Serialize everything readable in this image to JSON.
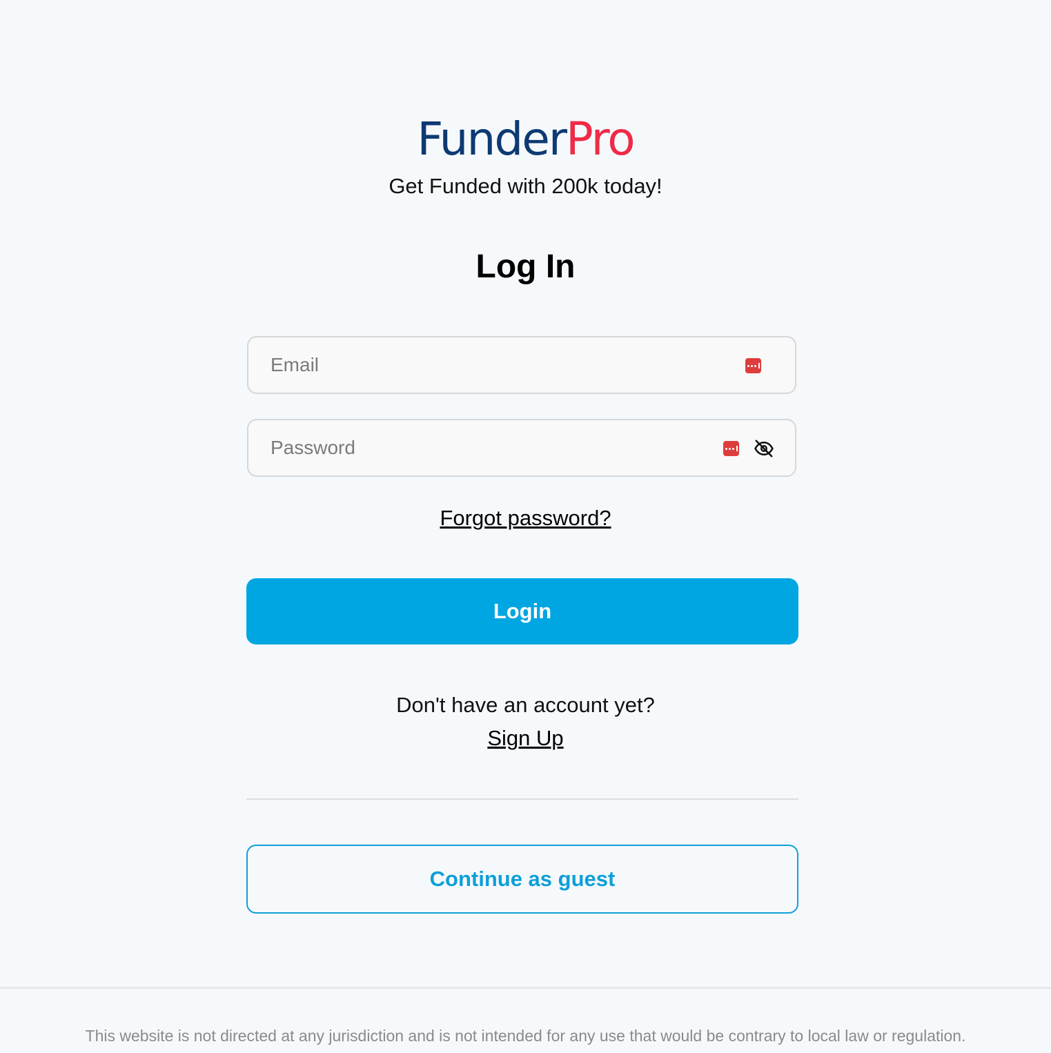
{
  "brand": {
    "name_part1": "Funder",
    "name_part2": "Pro",
    "color_primary": "#0d3a73",
    "color_accent": "#ef2b47"
  },
  "tagline": "Get Funded with 200k today!",
  "title": "Log In",
  "form": {
    "email_placeholder": "Email",
    "password_placeholder": "Password",
    "autofill_icon": "password-manager-icon",
    "visibility_icon": "eye-slash-icon",
    "forgot_password_label": "Forgot password?",
    "login_label": "Login",
    "login_color": "#00a6e2"
  },
  "signup": {
    "prompt": "Don't have an account yet?",
    "link_label": "Sign Up"
  },
  "guest": {
    "label": "Continue as guest",
    "color": "#0d9fd8"
  },
  "footer": {
    "disclaimer": "This website is not directed at any jurisdiction and is not intended for any use that would be contrary to local law or regulation."
  }
}
